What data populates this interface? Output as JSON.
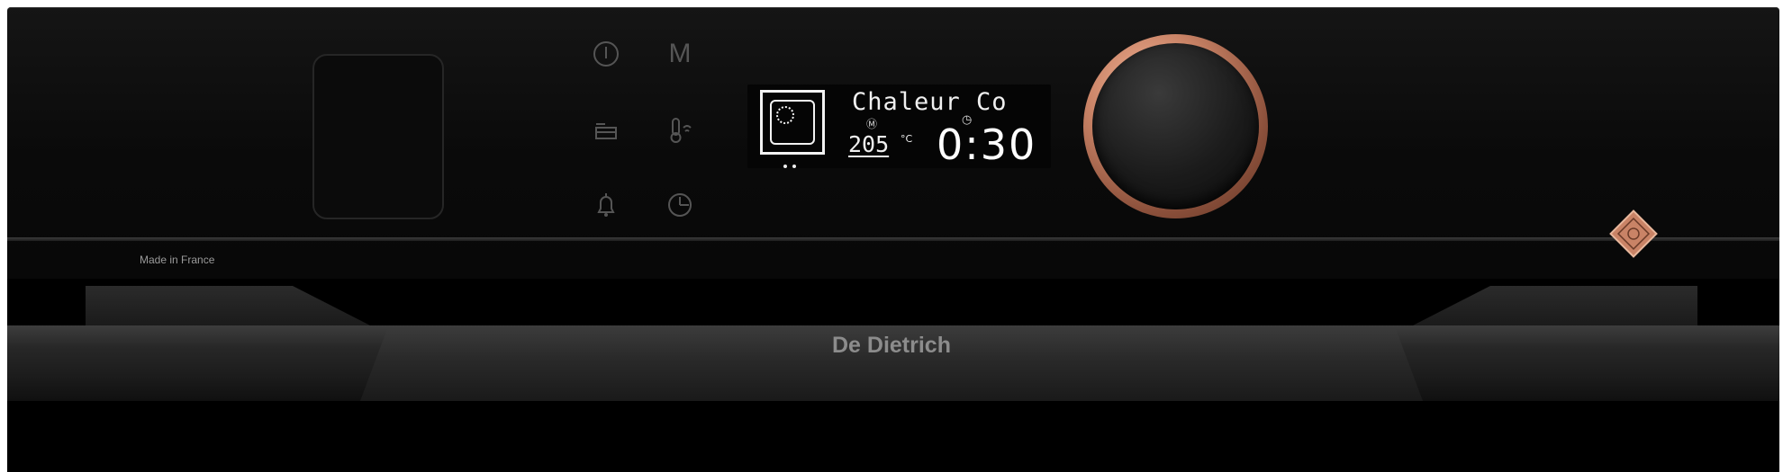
{
  "control_panel": {
    "made_in": "Made in France",
    "touch_icons": [
      {
        "name": "power-icon"
      },
      {
        "name": "menu-m-icon",
        "label": "M"
      },
      {
        "name": "tray-icon"
      },
      {
        "name": "thermometer-icon"
      },
      {
        "name": "bell-icon"
      },
      {
        "name": "clock-icon"
      }
    ]
  },
  "display": {
    "mode_text": "Chaleur Co",
    "temperature": "205",
    "temperature_unit": "°C",
    "timer": "0:30",
    "indicator_m": "M"
  },
  "door": {
    "brand": "De Dietrich"
  },
  "colors": {
    "panel": "#0d0d0d",
    "copper": "#c98366",
    "display_text": "#f0f0f0"
  }
}
